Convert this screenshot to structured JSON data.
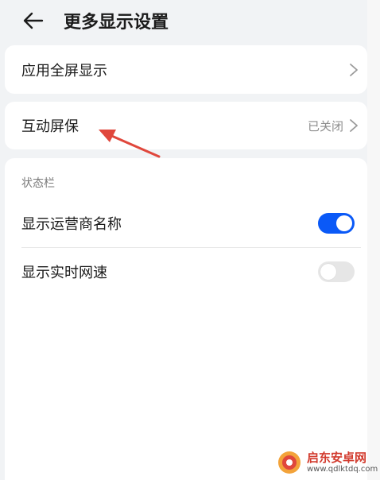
{
  "header": {
    "title": "更多显示设置",
    "back_icon": "arrow-left-icon"
  },
  "items": {
    "fullscreen": {
      "label": "应用全屏显示"
    },
    "screensaver": {
      "label": "互动屏保",
      "status": "已关闭"
    }
  },
  "status_bar": {
    "section_title": "状态栏",
    "carrier": {
      "label": "显示运营商名称",
      "enabled": true
    },
    "net_speed": {
      "label": "显示实时网速",
      "enabled": false
    }
  },
  "watermark": {
    "name": "启东安卓网",
    "url": "www.qdlktdq.com"
  },
  "colors": {
    "accent": "#0a59f7",
    "annotation": "#e0473c",
    "background": "#f1f3f5"
  }
}
